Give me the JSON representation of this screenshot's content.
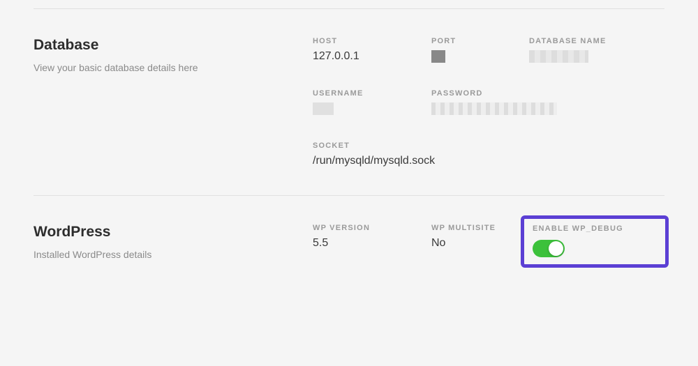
{
  "database": {
    "title": "Database",
    "subtitle": "View your basic database details here",
    "fields": {
      "host": {
        "label": "HOST",
        "value": "127.0.0.1"
      },
      "port": {
        "label": "PORT"
      },
      "dbname": {
        "label": "DATABASE NAME"
      },
      "username": {
        "label": "USERNAME"
      },
      "password": {
        "label": "PASSWORD"
      },
      "socket": {
        "label": "SOCKET",
        "value": "/run/mysqld/mysqld.sock"
      }
    }
  },
  "wordpress": {
    "title": "WordPress",
    "subtitle": "Installed WordPress details",
    "fields": {
      "version": {
        "label": "WP VERSION",
        "value": "5.5"
      },
      "multisite": {
        "label": "WP MULTISITE",
        "value": "No"
      },
      "debug": {
        "label": "ENABLE WP_DEBUG",
        "enabled": true
      }
    }
  }
}
